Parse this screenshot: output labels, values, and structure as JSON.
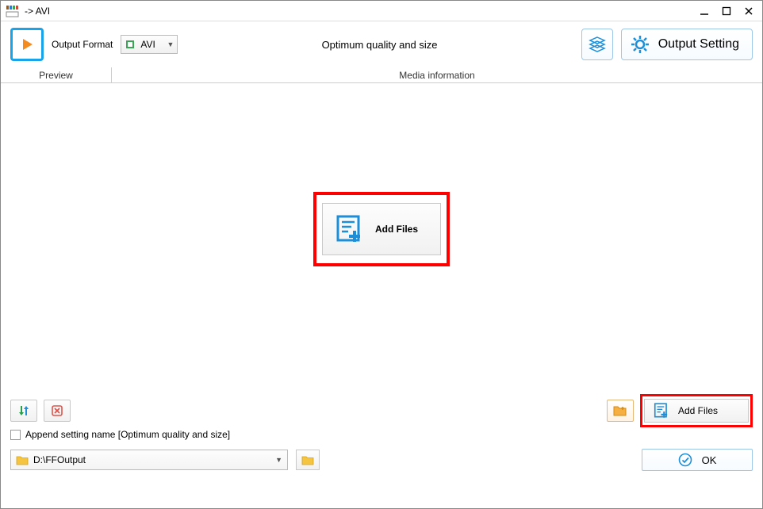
{
  "title": " -> AVI",
  "toolbar": {
    "output_format_label": "Output Format",
    "format_value": "AVI",
    "center_text": "Optimum quality and size",
    "output_setting_label": "Output Setting"
  },
  "headers": {
    "preview": "Preview",
    "media_info": "Media information"
  },
  "main": {
    "add_files_label": "Add Files"
  },
  "bottom": {
    "add_files_label": "Add Files",
    "append_label": "Append setting name [Optimum quality and size]",
    "output_path": "D:\\FFOutput",
    "ok_label": "OK"
  }
}
